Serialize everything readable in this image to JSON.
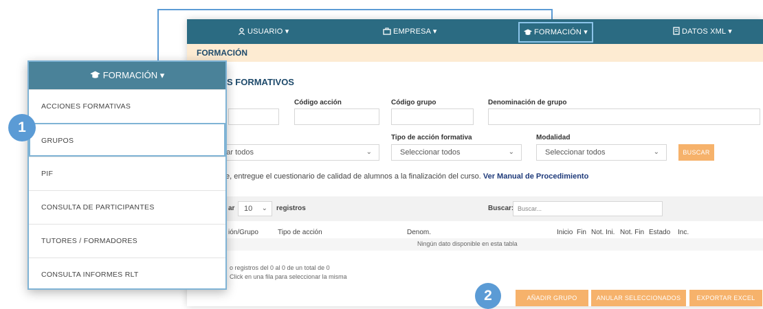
{
  "navbar": {
    "usuario": "USUARIO",
    "empresa": "EMPRESA",
    "formacion": "FORMACIÓN",
    "datos_xml": "DATOS XML"
  },
  "breadcrumb": "FORMACIÓN",
  "section_title": "S FORMATIVOS",
  "filters": {
    "codigo_accion": "Código acción",
    "codigo_grupo": "Código grupo",
    "denominacion_grupo": "Denominación de grupo",
    "tipo_accion_formativa": "Tipo de acción formativa",
    "modalidad": "Modalidad",
    "select_first": "onar todos",
    "select_tipo": "Seleccionar todos",
    "select_modalidad": "Seleccionar todos",
    "buscar_button": "BUSCAR"
  },
  "notice": {
    "text": "e, entregue el cuestionario de calidad de alumnos a la finalización del curso.",
    "link": "Ver Manual de Procedimiento"
  },
  "table_controls": {
    "show_prefix": "ar",
    "page_size": "10",
    "registros": "registros",
    "search_label": "Buscar:",
    "search_placeholder": "Buscar..."
  },
  "table": {
    "columns": [
      "ión/Grupo",
      "Tipo de acción",
      "Denom.",
      "Inicio",
      "Fin",
      "Not. Ini.",
      "Not. Fin",
      "Estado",
      "Inc."
    ],
    "empty": "Ningún dato disponible en esta tabla"
  },
  "footer": {
    "info": "o registros del 0 al 0 de un total de 0",
    "hint": "Click en una fila para seleccionar la misma"
  },
  "actions": {
    "anadir": "AÑADIR GRUPO",
    "anular": "ANULAR SELECCIONADOS",
    "exportar": "EXPORTAR EXCEL"
  },
  "dropdown": {
    "header": "FORMACIÓN",
    "items": [
      "ACCIONES FORMATIVAS",
      "GRUPOS",
      "PIF",
      "CONSULTA DE PARTICIPANTES",
      "TUTORES / FORMADORES",
      "CONSULTA INFORMES RLT"
    ]
  },
  "callouts": [
    "1",
    "2"
  ],
  "colors": {
    "navbar": "#2b6b82",
    "accent_orange": "#f6b26b",
    "callout_blue": "#5b9bd5"
  }
}
